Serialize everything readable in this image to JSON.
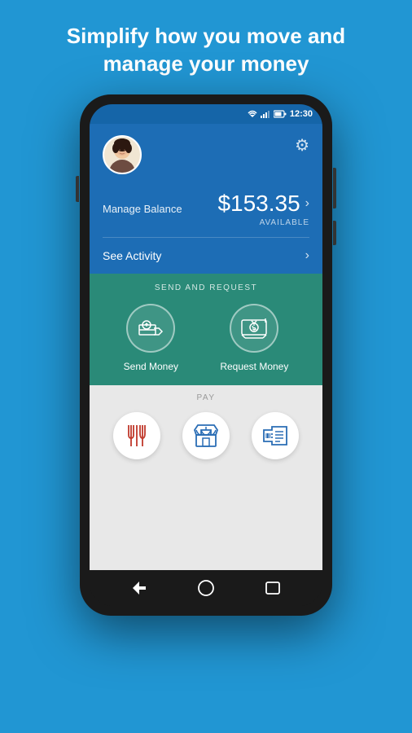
{
  "page": {
    "header_line1": "Simplify how you move and",
    "header_line2": "manage your money"
  },
  "status_bar": {
    "time": "12:30"
  },
  "profile": {
    "alt": "User avatar"
  },
  "balance": {
    "label": "Manage Balance",
    "amount": "$153.35",
    "sub_label": "AVAILABLE"
  },
  "activity": {
    "label": "See Activity"
  },
  "send_request": {
    "section_label": "SEND AND REQUEST",
    "send_label": "Send Money",
    "request_label": "Request Money"
  },
  "pay": {
    "section_label": "PAY"
  }
}
